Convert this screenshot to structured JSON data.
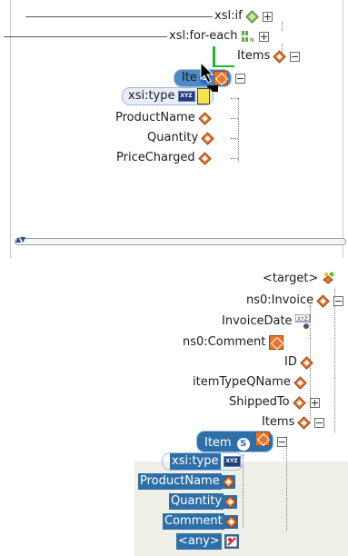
{
  "top_tree": {
    "xsl_if": "xsl:if",
    "xsl_for_each": "xsl:for-each",
    "items": "Items",
    "item": "Ite",
    "xsi_type": "xsi:type",
    "product_name": "ProductName",
    "quantity": "Quantity",
    "price_charged": "PriceCharged"
  },
  "bottom_tree": {
    "target": "<target>",
    "invoice": "ns0:Invoice",
    "invoice_date": "InvoiceDate",
    "comment_ns": "ns0:Comment",
    "id": "ID",
    "item_type_qname": "itemTypeQName",
    "shipped_to": "ShippedTo",
    "items": "Items",
    "item": "Item",
    "xsi_type": "xsi:type",
    "product_name": "ProductName",
    "quantity": "Quantity",
    "comment": "Comment",
    "any": "<any>"
  },
  "badges": {
    "s": "S",
    "xyz": "XYZ"
  },
  "colors": {
    "selection": "#2f6fa8",
    "element_icon": "#e8752b",
    "if_icon": "#5c9c3a",
    "drag_line": "#1db82b"
  }
}
